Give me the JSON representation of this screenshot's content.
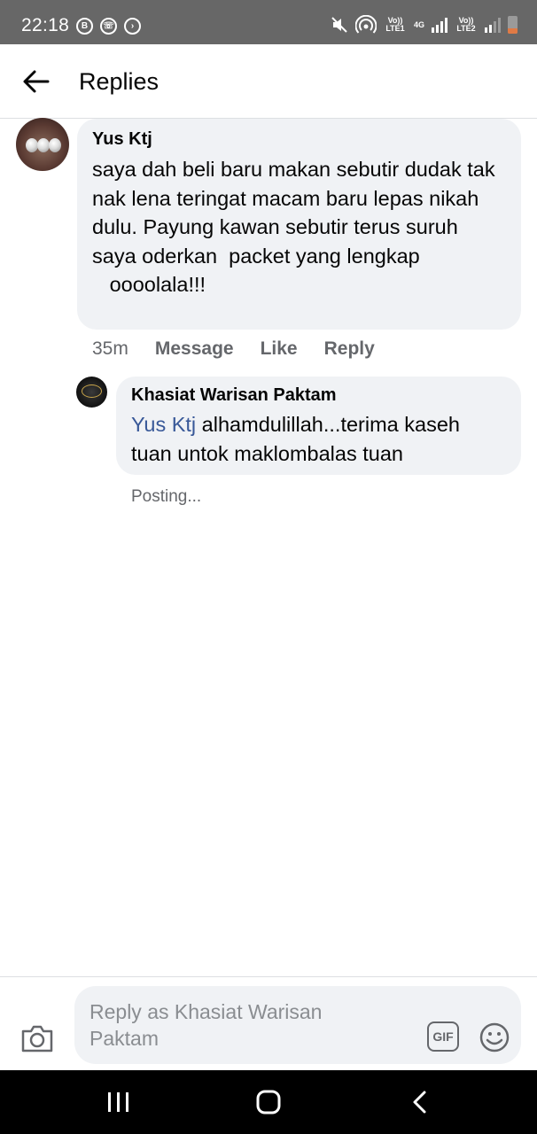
{
  "status_bar": {
    "time": "22:18",
    "left_icons": [
      "b-circle-icon",
      "whatsapp-business-icon",
      "nav-arrow-icon"
    ],
    "net1_label": "Vo)) LTE1",
    "net_4g_label": "4G",
    "net2_label": "Vo)) LTE2",
    "right_icons": [
      "mute-icon",
      "hotspot-icon",
      "signal-icon",
      "battery-icon"
    ]
  },
  "header": {
    "title": "Replies"
  },
  "comment": {
    "author": "Yus Ktj",
    "text": "saya dah beli baru makan sebutir dudak tak nak lena teringat macam baru lepas nikah dulu. Payung kawan sebutir terus suruh saya oderkan  packet yang lengkap\n   oooolala!!!",
    "time": "35m",
    "actions": {
      "message": "Message",
      "like": "Like",
      "reply": "Reply"
    }
  },
  "reply": {
    "author": "Khasiat Warisan Paktam",
    "mention": "Yus Ktj",
    "text": " alhamdulillah...terima kaseh tuan untok maklombalas tuan",
    "status": "Posting..."
  },
  "composer": {
    "placeholder": "Reply as Khasiat Warisan Paktam",
    "gif_label": "GIF"
  },
  "colors": {
    "status_bar": "#676767",
    "bubble": "#f0f2f5",
    "mention": "#385898",
    "secondary_text": "#65676b"
  }
}
